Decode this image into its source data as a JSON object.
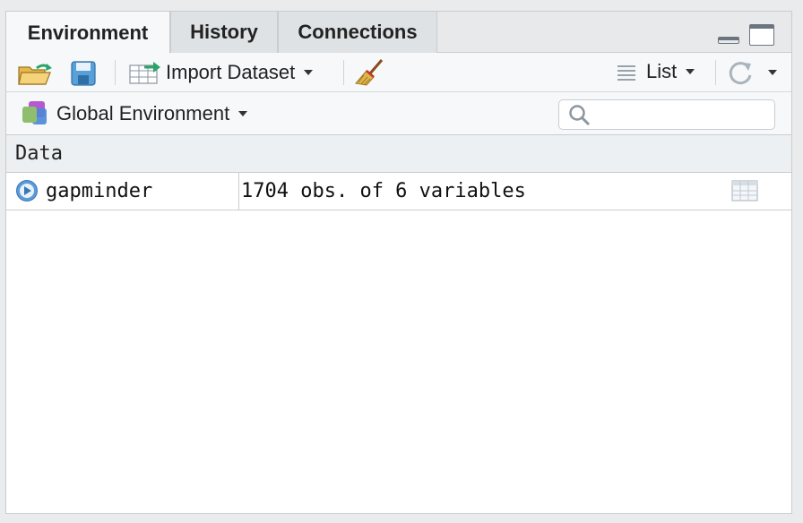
{
  "tabs": [
    {
      "label": "Environment",
      "active": true
    },
    {
      "label": "History",
      "active": false
    },
    {
      "label": "Connections",
      "active": false
    }
  ],
  "toolbar": {
    "import_label": "Import Dataset",
    "view_mode_label": "List"
  },
  "env_selector": {
    "label": "Global Environment"
  },
  "search": {
    "placeholder": "",
    "value": ""
  },
  "section": {
    "header": "Data"
  },
  "rows": [
    {
      "name": "gapminder",
      "value": "1704 obs. of 6 variables"
    }
  ],
  "colors": {
    "accent": "#4a90d9",
    "tab_bg": "#e7e9eb",
    "toolbar_bg": "#f6f8f9",
    "border": "#c9cdd1"
  }
}
